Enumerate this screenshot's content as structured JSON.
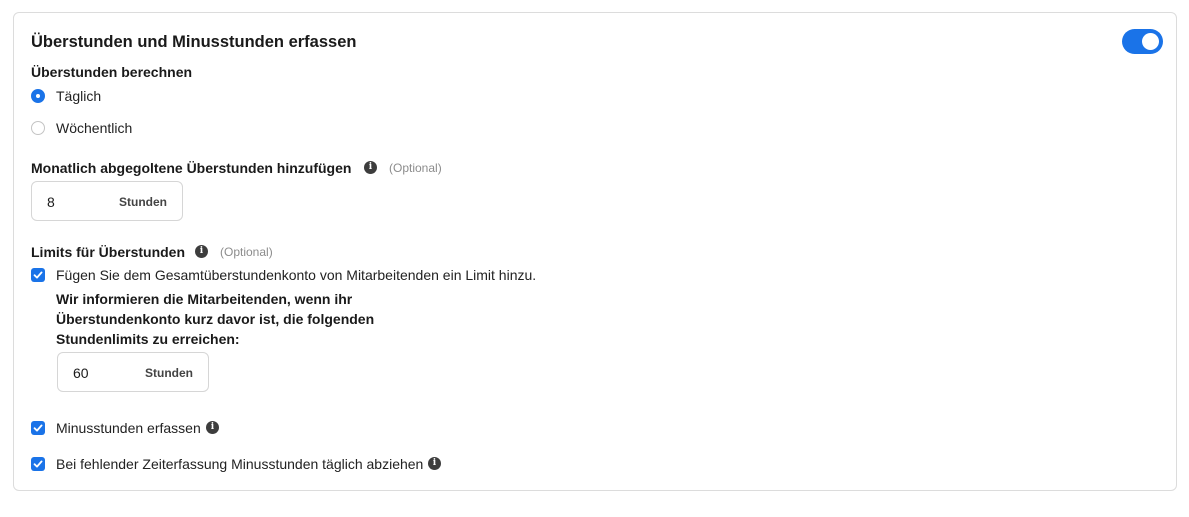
{
  "title": "Überstunden und Minusstunden erfassen",
  "toggle_on": true,
  "calc": {
    "label": "Überstunden berechnen",
    "options": [
      {
        "label": "Täglich",
        "selected": true
      },
      {
        "label": "Wöchentlich",
        "selected": false
      }
    ]
  },
  "monthly": {
    "label": "Monatlich abgegoltene Überstunden hinzufügen",
    "optional": "(Optional)",
    "value": "8",
    "unit": "Stunden"
  },
  "limits": {
    "label": "Limits für Überstunden",
    "optional": "(Optional)",
    "checkbox_label": "Fügen Sie dem Gesamtüberstundenkonto von Mitarbeitenden ein Limit hinzu.",
    "note_lines": [
      "Wir informieren die Mitarbeitenden, wenn ihr",
      "Überstundenkonto kurz davor ist, die folgenden",
      "Stundenlimits zu erreichen:"
    ],
    "value": "60",
    "unit": "Stunden"
  },
  "minus": {
    "label": "Minusstunden erfassen"
  },
  "deduct": {
    "label": "Bei fehlender Zeiterfassung Minusstunden täglich abziehen"
  },
  "colors": {
    "accent": "#1a73e8",
    "info_icon": "#3d3d3d",
    "optional_text": "#8c8c8c"
  },
  "icons": {
    "info": "info-icon",
    "check": "check-icon"
  }
}
